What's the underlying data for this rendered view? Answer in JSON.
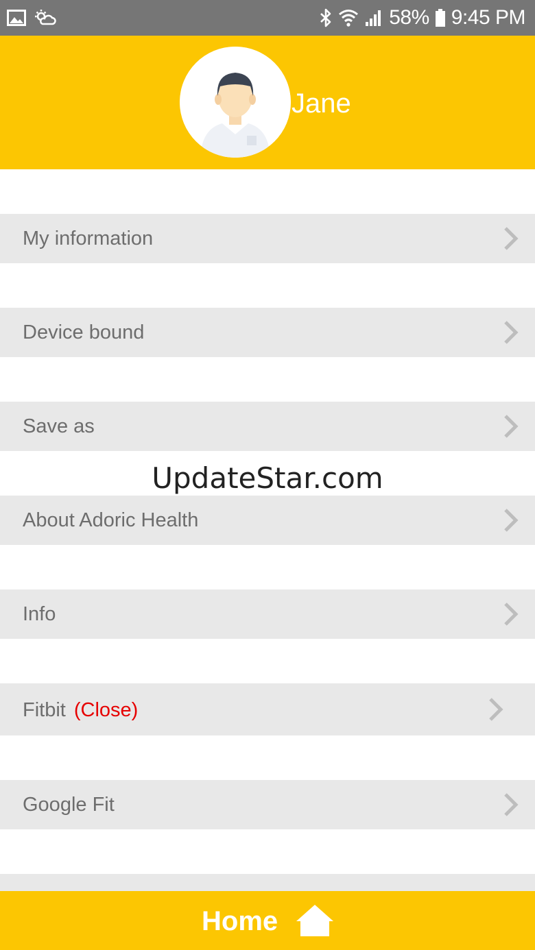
{
  "status_bar": {
    "battery": "58%",
    "time": "9:45 PM",
    "icons": [
      "image-icon",
      "weather-icon",
      "bluetooth-icon",
      "wifi-icon",
      "signal-icon",
      "battery-icon"
    ]
  },
  "profile": {
    "name": "Jane",
    "avatar_icon": "user-avatar-icon"
  },
  "menu": {
    "items": [
      {
        "label": "My information"
      },
      {
        "label": "Device bound"
      },
      {
        "label": "Save as"
      },
      {
        "label": "About Adoric Health"
      },
      {
        "label": "Info"
      },
      {
        "label": "Fitbit",
        "status": "(Close)"
      },
      {
        "label": "Google Fit"
      }
    ]
  },
  "watermark": "UpdateStar.com",
  "footer": {
    "home_label": "Home",
    "home_icon": "house-icon"
  },
  "colors": {
    "brand_yellow": "#fcc602",
    "row_background": "#e8e8e8",
    "label_gray": "#6d6d6d",
    "status_red": "#e60000",
    "status_bar": "#767676"
  }
}
